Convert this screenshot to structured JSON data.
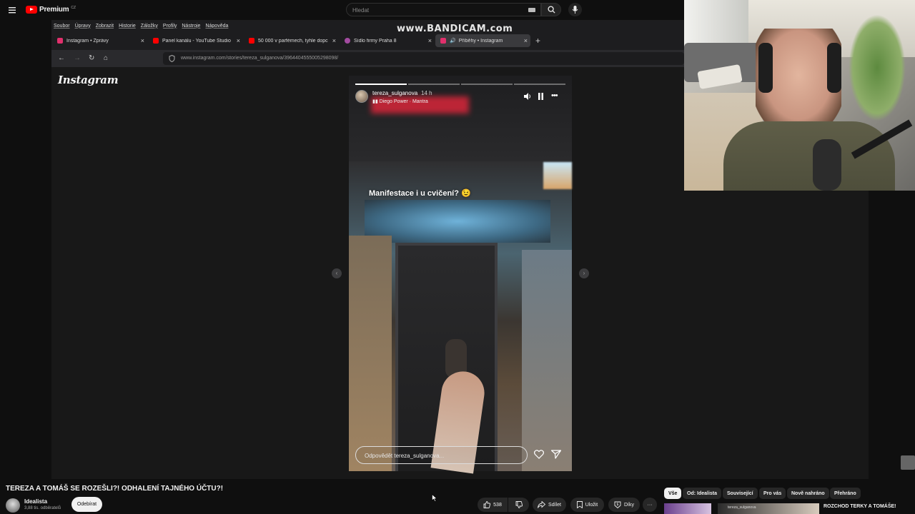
{
  "youtube": {
    "logo_text": "Premium",
    "region": "CZ",
    "search_placeholder": "Hledat"
  },
  "watermark": "www.BANDICAM.com",
  "browser": {
    "menu": [
      "Soubor",
      "Úpravy",
      "Zobrazit",
      "Historie",
      "Záložky",
      "Profily",
      "Nástroje",
      "Nápověda"
    ],
    "tabs": [
      {
        "label": "Instagram • Zprávy",
        "close": "×",
        "color": "#e1306c"
      },
      {
        "label": "Panel kanálu - YouTube Studio",
        "close": "×",
        "color": "#ff0000"
      },
      {
        "label": "50 000 v parfémech, tyhle dopc",
        "close": "×",
        "color": "#ff0000"
      },
      {
        "label": "Sídlo firmy Praha 8",
        "close": "×",
        "color": "#a34ba0"
      },
      {
        "label": "Příběhy • Instagram",
        "close": "×",
        "color": "#e1306c"
      }
    ],
    "new_tab": "+",
    "url": "www.instagram.com/stories/tereza_sulganova/3964404555005298098/"
  },
  "instagram": {
    "logo": "Instagram",
    "story": {
      "username": "tereza_sulganova",
      "time_ago": "14 h",
      "music": "Diego Power · Mantra",
      "caption": "Manifestace i u cvičení? 😉",
      "reply_placeholder": "Odpovědět tereza_sulganova...",
      "segments_done": 1,
      "segments_total": 4
    }
  },
  "video": {
    "title": "TEREZA A TOMÁŠ SE ROZEŠLI?! ODHALENÍ TAJNÉHO ÚČTU?!",
    "channel": "Idealista",
    "subscribers": "3,88 tis. odběratelů",
    "subscribe_label": "Odebírat",
    "likes": "538",
    "share_label": "Sdílet",
    "save_label": "Uložit",
    "thanks_label": "Díky",
    "more_label": "···"
  },
  "chips": [
    "Vše",
    "Od: Idealista",
    "Související",
    "Pro vás",
    "Nově nahráno",
    "Přehráno"
  ],
  "related": {
    "title": "ROZCHOD TERKY A TOMÁŠE!",
    "overlay_user": "tereza_sulganova"
  }
}
